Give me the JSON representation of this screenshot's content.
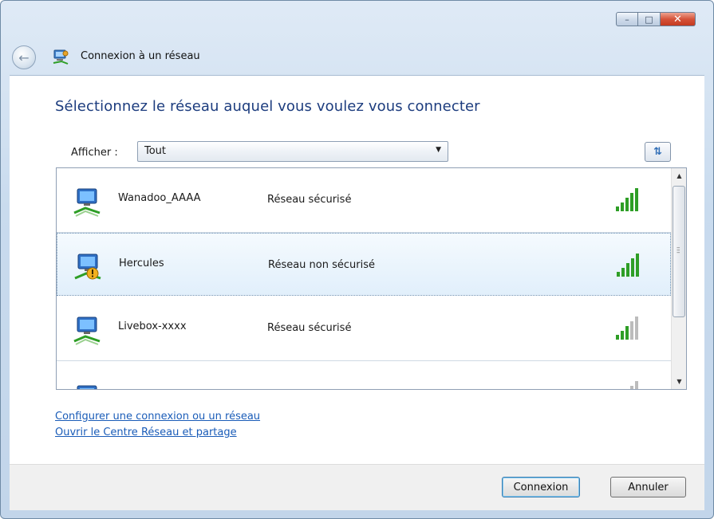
{
  "window": {
    "title": "Connexion à un réseau",
    "controls": {
      "minimize": "–",
      "maximize": "□",
      "close": "✕"
    }
  },
  "heading": "Sélectionnez le réseau auquel vous voulez vous connecter",
  "filter": {
    "label": "Afficher :",
    "value": "Tout"
  },
  "networks": [
    {
      "name": "Wanadoo_AAAA",
      "status": "Réseau sécurisé",
      "signal_bars": 5,
      "secure": true,
      "selected": false
    },
    {
      "name": "Hercules",
      "status": "Réseau non sécurisé",
      "signal_bars": 5,
      "secure": false,
      "selected": true
    },
    {
      "name": "Livebox-xxxx",
      "status": "Réseau sécurisé",
      "signal_bars": 3,
      "secure": true,
      "selected": false
    },
    {
      "name": "",
      "status": "",
      "signal_bars": 1,
      "secure": true,
      "selected": false
    }
  ],
  "links": {
    "setup": "Configurer une connexion ou un réseau",
    "center": "Ouvrir le Centre Réseau et partage"
  },
  "buttons": {
    "connect": "Connexion",
    "cancel": "Annuler"
  },
  "colors": {
    "heading": "#1c3c7e",
    "link": "#1a5cb8",
    "signal_active": "#2e9e26",
    "signal_inactive": "#bcbcbc",
    "selection": "#e1effb"
  }
}
